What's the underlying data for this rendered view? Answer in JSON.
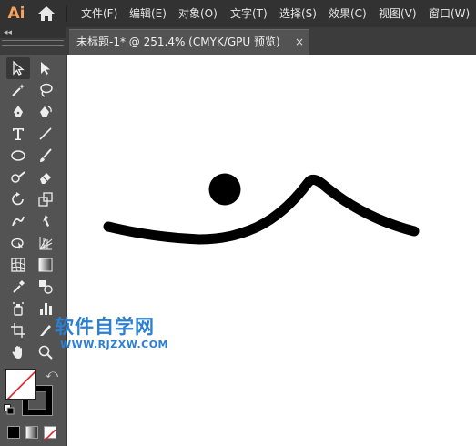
{
  "app": {
    "logo": "Ai"
  },
  "menu": {
    "items": [
      {
        "label": "文件(F)"
      },
      {
        "label": "编辑(E)"
      },
      {
        "label": "对象(O)"
      },
      {
        "label": "文字(T)"
      },
      {
        "label": "选择(S)"
      },
      {
        "label": "效果(C)"
      },
      {
        "label": "视图(V)"
      },
      {
        "label": "窗口(W)"
      }
    ]
  },
  "document_tab": {
    "title": "未标题-1* @ 251.4% (CMYK/GPU 预览)",
    "close": "×"
  },
  "toolbar": {
    "collapse_glyph": "◂◂",
    "tools": [
      "selection-tool-icon",
      "direct-selection-tool-icon",
      "magic-wand-tool-icon",
      "lasso-tool-icon",
      "pen-tool-icon",
      "curvature-tool-icon",
      "type-tool-icon",
      "line-segment-tool-icon",
      "ellipse-tool-icon",
      "paintbrush-tool-icon",
      "shaper-tool-icon",
      "eraser-tool-icon",
      "rotate-tool-icon",
      "scale-tool-icon",
      "puppet-warp-tool-icon",
      "free-transform-tool-icon",
      "shape-builder-tool-icon",
      "perspective-grid-tool-icon",
      "mesh-tool-icon",
      "gradient-tool-icon",
      "eyedropper-tool-icon",
      "blend-tool-icon",
      "symbol-sprayer-tool-icon",
      "column-graph-tool-icon",
      "artboard-tool-icon",
      "slice-tool-icon",
      "hand-tool-icon",
      "zoom-tool-icon"
    ],
    "fill": "none",
    "stroke": "#000000"
  },
  "colors": {
    "menubar": "#323232",
    "panel": "#535353",
    "canvas": "#ffffff",
    "artwork": "#000000",
    "watermark": "#2b7fd2",
    "logo": "#f7a35c"
  },
  "watermark": {
    "name": "软件自学网",
    "url": "WWW.RJZXW.COM"
  }
}
